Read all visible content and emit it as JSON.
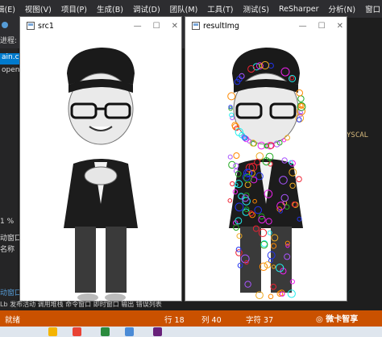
{
  "menu": [
    "辑(E)",
    "视图(V)",
    "项目(P)",
    "生成(B)",
    "调试(D)",
    "团队(M)",
    "工具(T)",
    "测试(S)",
    "ReSharper",
    "分析(N)",
    "窗口"
  ],
  "left_panel": {
    "process_label": "进程:",
    "file_tab": "ain.cpp",
    "open_text": "open",
    "zoom": "1 %",
    "window_label": "动窗口",
    "name_label": "名称",
    "bottom_tab": "动窗口"
  },
  "right_code_text": "YSCAL",
  "window_src": {
    "title": "src1",
    "minimize": "—",
    "maximize": "☐",
    "close": "✕"
  },
  "window_result": {
    "title": "resultImg",
    "minimize": "—",
    "maximize": "☐",
    "close": "✕"
  },
  "bottom_tabs": "Lb 发布活动  调用堆栈  命令窗口  即时窗口  输出  错误列表",
  "status": {
    "ready": "就绪",
    "line": "行 18",
    "col": "列 40",
    "char": "字符 37"
  },
  "watermark": "微卡智享",
  "colors": {
    "status_bg": "#ca5100",
    "menubar_bg": "#2d2d30",
    "ide_bg": "#1e1e1e"
  }
}
